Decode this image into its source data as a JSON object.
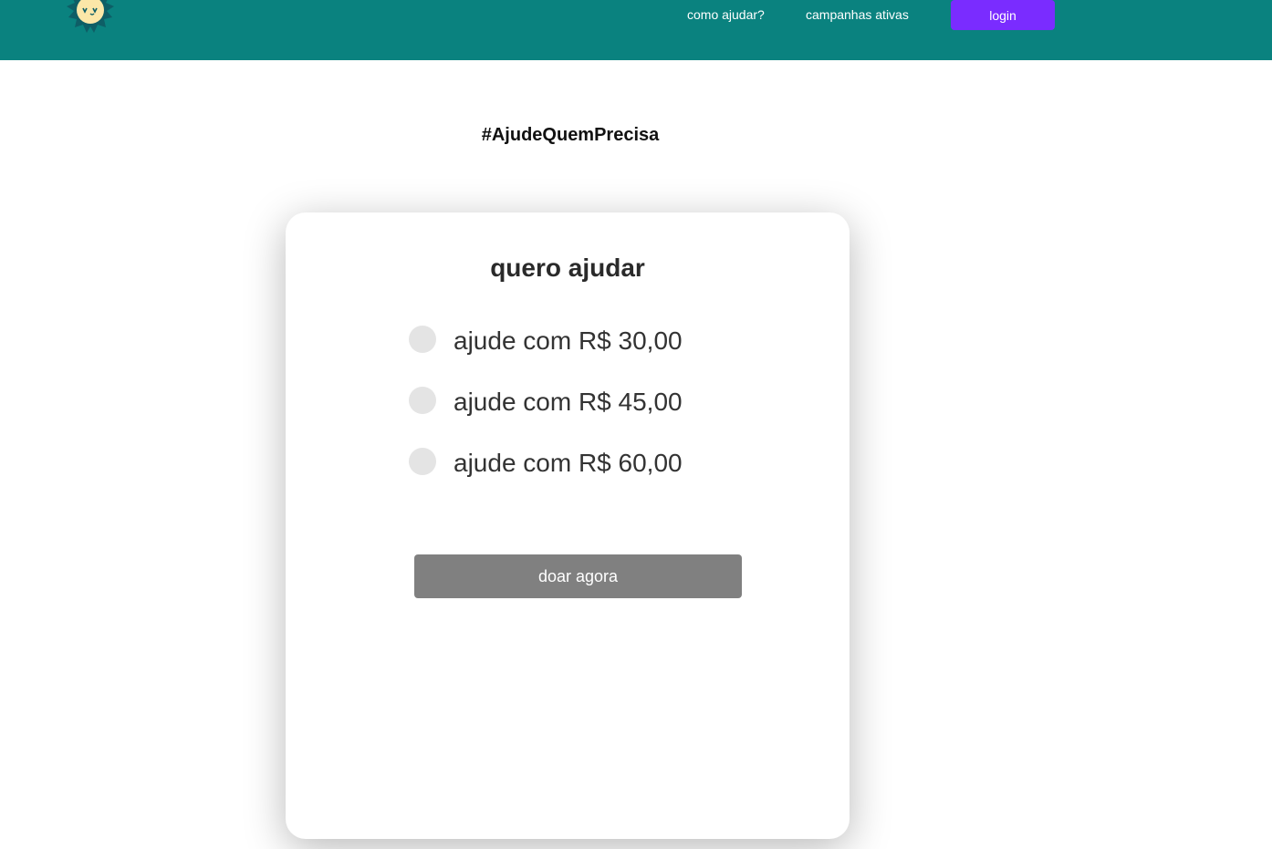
{
  "header": {
    "logo_icon": "sun-face-logo-icon",
    "nav": [
      {
        "label": "como ajudar?"
      },
      {
        "label": "campanhas ativas"
      }
    ],
    "login_label": "login",
    "colors": {
      "bar": "#0a827f",
      "login": "#7a2cff"
    }
  },
  "main": {
    "hashtag": "#AjudeQuemPrecisa",
    "card": {
      "title": "quero ajudar",
      "options": [
        {
          "label": "ajude com R$ 30,00",
          "selected": false
        },
        {
          "label": "ajude com R$ 45,00",
          "selected": false
        },
        {
          "label": "ajude com R$ 60,00",
          "selected": false
        }
      ],
      "submit_label": "doar agora"
    }
  }
}
